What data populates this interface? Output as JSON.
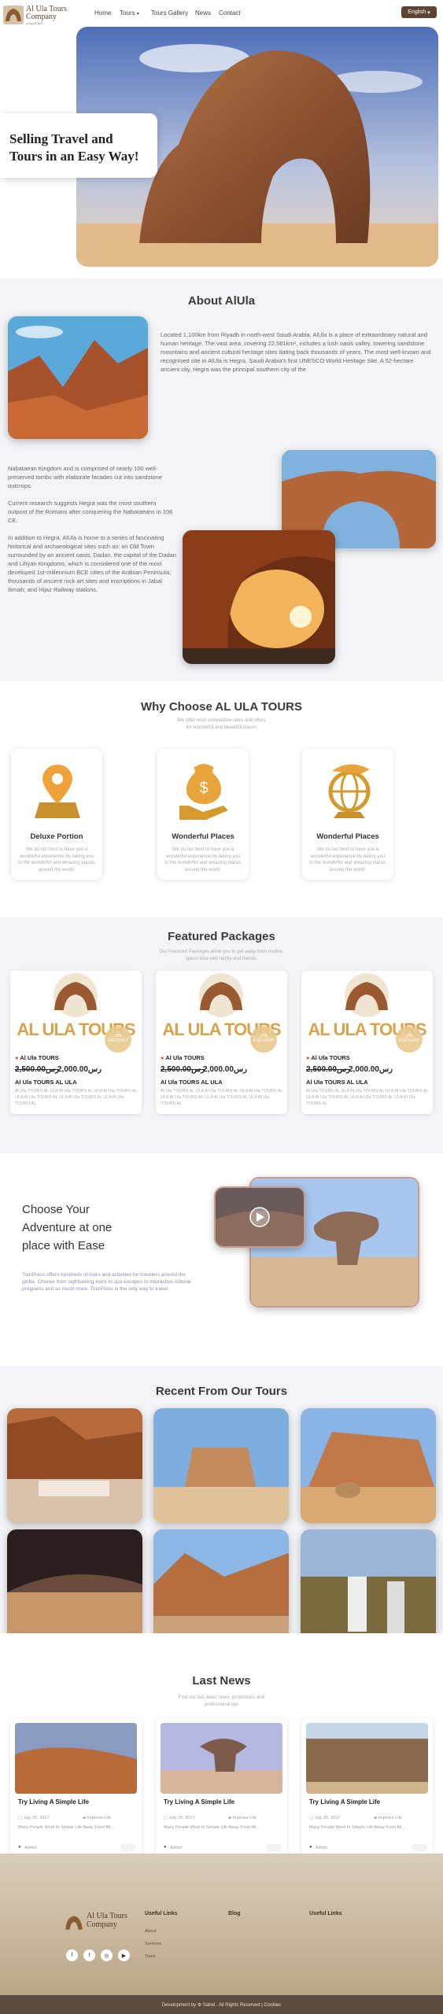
{
  "nav": {
    "logo_text": "Al Ula Tours Company",
    "logo_sub": "العلا للسياحة",
    "links": [
      "Home",
      "Tours",
      "Tours Gallery",
      "News",
      "Contact"
    ],
    "lang": "English"
  },
  "hero": {
    "title_line1": "Selling Travel and",
    "title_line2": "Tours in an Easy Way!"
  },
  "about": {
    "title": "About AlUla",
    "p1": "Located 1,100km from Riyadh in north-west Saudi Arabia, AlUla is a place of extraordinary natural and human heritage. The vast area, covering 22,561km², includes a lush oasis valley, towering sandstone mountains and ancient cultural heritage sites dating back thousands of years. The most well-known and recognised site in AlUla is Hegra, Saudi Arabia's first UNESCO World Heritage Site. A 52-hectare ancient city, Hegra was the principal southern city of the",
    "p2": "Nabataean Kingdom and is comprised of nearly 100 well-preserved tombs with elaborate facades cut into sandstone outcrops.",
    "p3": "Current research suggests Hegra was the most southern outpost of the Romans after conquering the Nabataeans in 106 CE.",
    "p4": "In addition to Hegra, AlUla is home to a series of fascinating historical and archaeological sites such as: an Old Town surrounded by an ancient oasis, Dadan, the capital of the Dadan and Lihyan Kingdoms, which is considered one of the most developed 1st-millennium BCE cities of the Arabian Peninsula; thousands of ancient rock art sites and inscriptions in Jabal Ikmah; and Hijaz Railway stations."
  },
  "why": {
    "title": "Why Choose AL ULA TOURS",
    "sub1": "We offer most competitive rates and offers",
    "sub2": "for wonderful and beautiful places",
    "cards": [
      {
        "title": "Deluxe Portion",
        "icon": "map-pin-icon",
        "desc": "We do our best to have you a wonderful experience by taking you to the wonderful and amazing places around the world."
      },
      {
        "title": "Wonderful Places",
        "icon": "money-hand-icon",
        "desc": "We do our best to have you a wonderful experience by taking you to the wonderful and amazing places around the world."
      },
      {
        "title": "Wonderful Places",
        "icon": "globe-plane-icon",
        "desc": "We do our best to have you a wonderful experience by taking you to the wonderful and amazing places around the world."
      }
    ]
  },
  "featured": {
    "title": "Featured Packages",
    "sub1": "Our Featured Packages allow you to get away from routine,",
    "sub2": "spend time with family and friends.",
    "brand": "AL ULA TOURS",
    "badge1": "10%",
    "badge2": "DISCOUNT",
    "packages": [
      {
        "location": "Al Ula TOURS",
        "old_price": "2,500.00رس",
        "new_price": "2,000.00رس",
        "name": "Al Ula TOURS AL ULA",
        "desc": "Al Ula TOURS AL ULA Al Ula TOURS AL ULA Al Ula TOURS AL ULA Al Ula TOURS AL ULA Al Ula TOURS AL ULA Al Ula TOURS AL"
      },
      {
        "location": "Al Ula TOURS",
        "old_price": "2,500.00رس",
        "new_price": "2,000.00رس",
        "name": "Al Ula TOURS AL ULA",
        "desc": "Al Ula TOURS AL ULA Al Ula TOURS AL ULA Al Ula TOURS AL ULA Al Ula TOURS AL ULA Al Ula TOURS AL ULA Al Ula TOURS AL"
      },
      {
        "location": "Al Ula TOURS",
        "old_price": "2,500.00رس",
        "new_price": "2,000.00رس",
        "name": "Al Ula TOURS AL ULA",
        "desc": "Al Ula TOURS AL ULA Al Ula TOURS AL ULA Al Ula TOURS AL ULA Al Ula TOURS AL ULA Al Ula TOURS AL ULA Al Ula TOURS AL"
      }
    ]
  },
  "choose": {
    "title_line1": "Choose Your",
    "title_line2": "Adventure at one",
    "title_line3": "place with Ease",
    "desc": "TourPress offers hundreds of tours and activities for travelers around the globe. Choose from sightseeing tours to spa escapes to interactive cultural programs and so much more. TourPress is the only way to travel."
  },
  "recent": {
    "title": "Recent From Our Tours"
  },
  "news": {
    "title": "Last News",
    "sub1": "Find our last latest news, promotions and",
    "sub2": "professional tips",
    "items": [
      {
        "title": "Try Living A Simple Life",
        "date": "July 25, 2017",
        "category": "Improve Life",
        "excerpt": "Many People Work In Simple Life Away From All...",
        "author": "Admin"
      },
      {
        "title": "Try Living A Simple Life",
        "date": "July 25, 2017",
        "category": "Improve Life",
        "excerpt": "Many People Work In Simple Life Away From All...",
        "author": "Admin"
      },
      {
        "title": "Try Living A Simple Life",
        "date": "July 25, 2017",
        "category": "Improve Life",
        "excerpt": "Many People Work In Simple Life Away From All...",
        "author": "Admin"
      }
    ]
  },
  "footer": {
    "col1": "Useful Links",
    "col2": "Blog",
    "col3": "Useful Links",
    "links1": [
      "About",
      "Services",
      "Tours"
    ],
    "copyright": "Development by ⚙ Sahel . All Rights Reserved | Cookies"
  },
  "colors": {
    "brand": "#5e4533",
    "accent": "#e8a33a",
    "gold": "#d49a2d"
  }
}
